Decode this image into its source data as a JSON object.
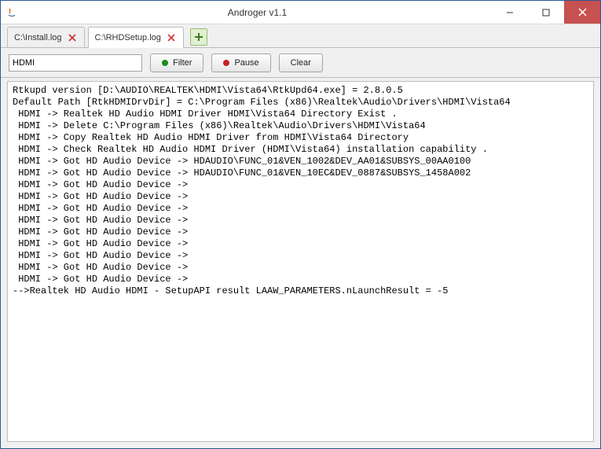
{
  "window": {
    "title": "Androger v1.1"
  },
  "tabs": [
    {
      "label": "C:\\Install.log",
      "active": false
    },
    {
      "label": "C:\\RHDSetup.log",
      "active": true
    }
  ],
  "toolbar": {
    "filter_value": "HDMI",
    "filter_label": "Filter",
    "pause_label": "Pause",
    "clear_label": "Clear"
  },
  "log_lines": [
    "Rtkupd version [D:\\AUDIO\\REALTEK\\HDMI\\Vista64\\RtkUpd64.exe] = 2.8.0.5",
    "Default Path [RtkHDMIDrvDir] = C:\\Program Files (x86)\\Realtek\\Audio\\Drivers\\HDMI\\Vista64",
    " HDMI -> Realtek HD Audio HDMI Driver HDMI\\Vista64 Directory Exist .",
    " HDMI -> Delete C:\\Program Files (x86)\\Realtek\\Audio\\Drivers\\HDMI\\Vista64",
    " HDMI -> Copy Realtek HD Audio HDMI Driver from HDMI\\Vista64 Directory",
    " HDMI -> Check Realtek HD Audio HDMI Driver (HDMI\\Vista64) installation capability .",
    " HDMI -> Got HD Audio Device -> HDAUDIO\\FUNC_01&VEN_1002&DEV_AA01&SUBSYS_00AA0100",
    " HDMI -> Got HD Audio Device -> HDAUDIO\\FUNC_01&VEN_10EC&DEV_0887&SUBSYS_1458A002",
    " HDMI -> Got HD Audio Device -> ",
    " HDMI -> Got HD Audio Device -> ",
    " HDMI -> Got HD Audio Device -> ",
    " HDMI -> Got HD Audio Device -> ",
    " HDMI -> Got HD Audio Device -> ",
    " HDMI -> Got HD Audio Device -> ",
    " HDMI -> Got HD Audio Device -> ",
    " HDMI -> Got HD Audio Device -> ",
    " HDMI -> Got HD Audio Device -> ",
    "-->Realtek HD Audio HDMI - SetupAPI result LAAW_PARAMETERS.nLaunchResult = -5"
  ]
}
